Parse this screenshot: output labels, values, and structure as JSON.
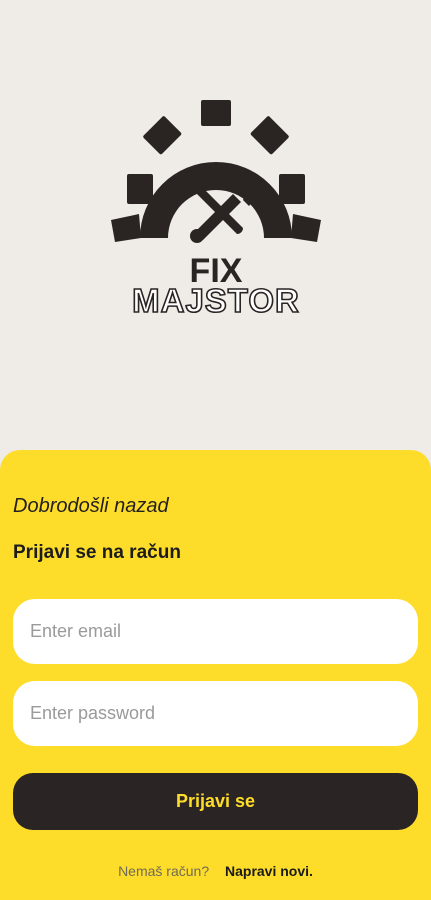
{
  "logo": {
    "line1": "FIX",
    "line2": "MAJSTOR",
    "icon": "gear-wrench-screwdriver-icon"
  },
  "login": {
    "welcome": "Dobrodošli nazad",
    "subtitle": "Prijavi se na račun",
    "email_placeholder": "Enter email",
    "email_value": "",
    "password_placeholder": "Enter password",
    "password_value": "",
    "submit_label": "Prijavi se",
    "no_account_text": "Nemaš račun?",
    "register_link": "Napravi novi."
  },
  "colors": {
    "background": "#efebe6",
    "accent": "#fedd2a",
    "dark": "#2b2424"
  }
}
